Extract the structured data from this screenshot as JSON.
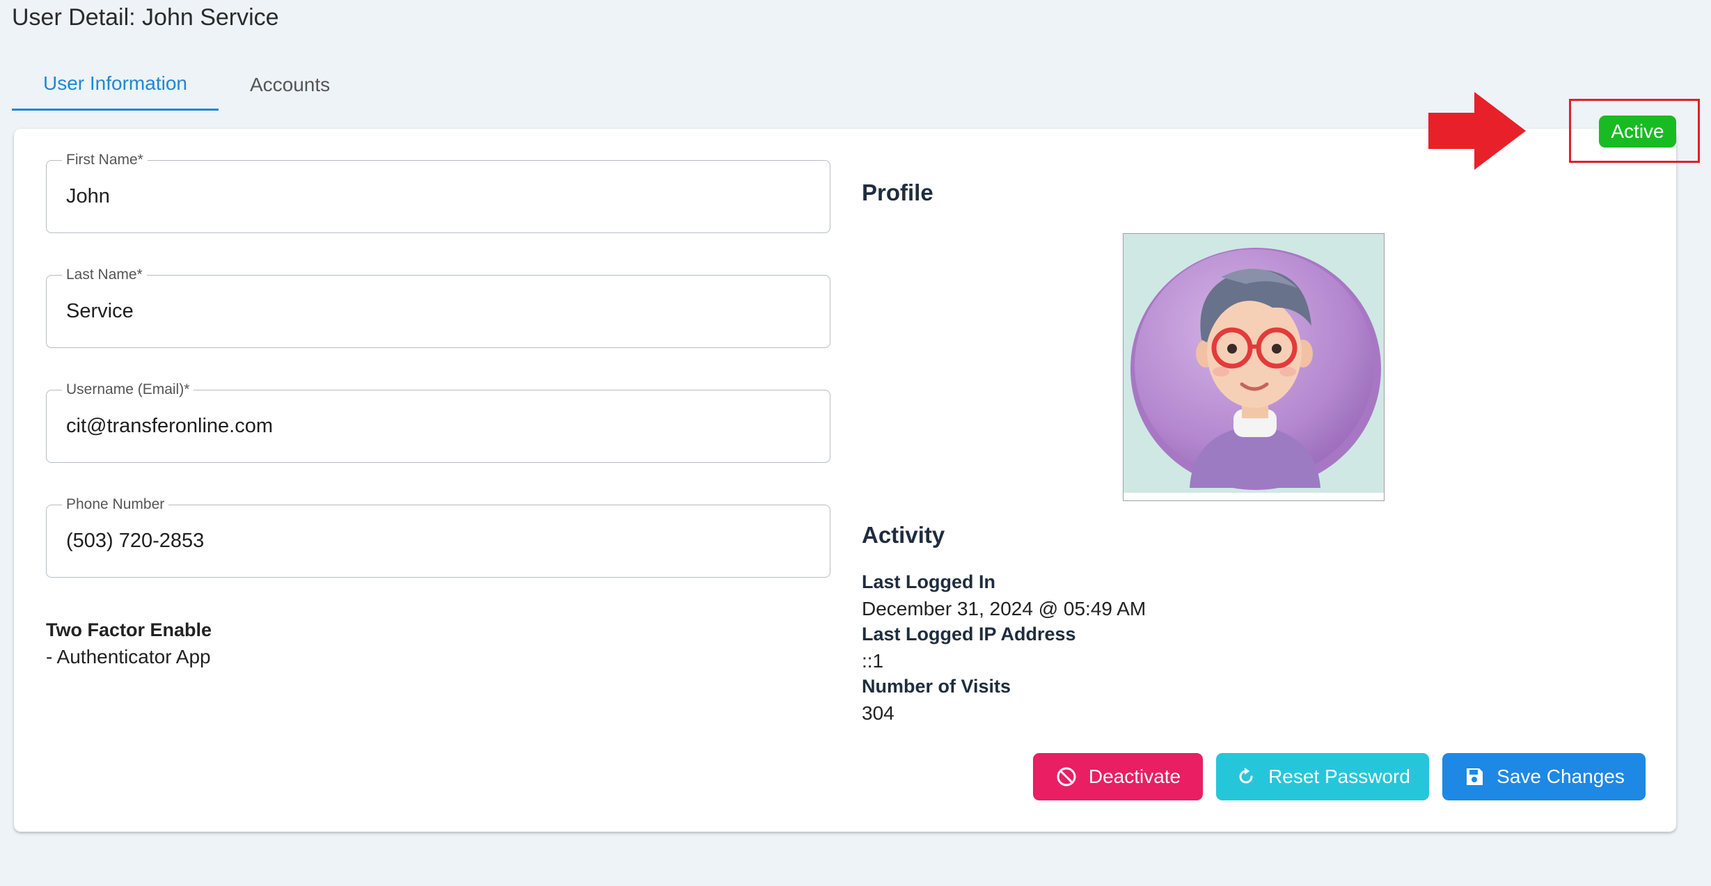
{
  "page_title": "User Detail: John Service",
  "tabs": [
    {
      "label": "User Information",
      "active": true
    },
    {
      "label": "Accounts",
      "active": false
    }
  ],
  "form": {
    "first_name": {
      "label": "First Name*",
      "value": "John"
    },
    "last_name": {
      "label": "Last Name*",
      "value": "Service"
    },
    "username": {
      "label": "Username (Email)*",
      "value": "cit@transferonline.com"
    },
    "phone": {
      "label": "Phone Number",
      "value": "(503) 720-2853"
    }
  },
  "two_factor": {
    "title": "Two Factor Enable",
    "value": "- Authenticator App"
  },
  "profile": {
    "heading": "Profile"
  },
  "activity": {
    "heading": "Activity",
    "last_logged_in_label": "Last Logged In",
    "last_logged_in_value": "December 31, 2024 @ 05:49 AM",
    "last_ip_label": "Last Logged IP Address",
    "last_ip_value": "::1",
    "visits_label": "Number of Visits",
    "visits_value": "304"
  },
  "buttons": {
    "deactivate": "Deactivate",
    "reset_password": "Reset Password",
    "save_changes": "Save Changes"
  },
  "status": {
    "label": "Active",
    "color": "#19bb22"
  },
  "colors": {
    "accent": "#1e88d6",
    "deactivate": "#e91e63",
    "reset": "#26c6da",
    "save": "#1e88e5",
    "annotation": "#e0202a"
  },
  "icons": {
    "deactivate": "block-icon",
    "reset_password": "refresh-icon",
    "save_changes": "floppy-disk-icon"
  }
}
